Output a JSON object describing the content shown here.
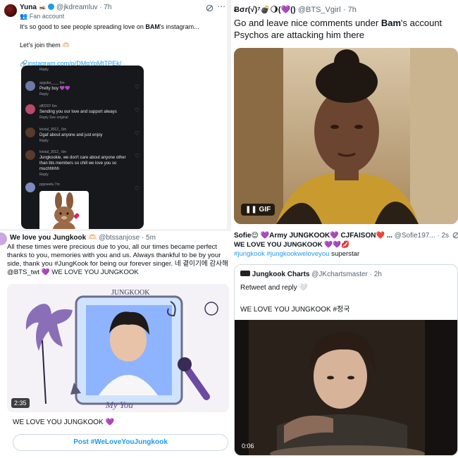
{
  "tl": {
    "name": "Yuna",
    "name_emoji": "🦗",
    "handle": "@jkdreamluv",
    "time": "· 7h",
    "fan_label": "Fan account",
    "line1_pre": "It's so good to see people spreading love on ",
    "line1_bold": "BAM",
    "line1_post": "'s instagram...",
    "line2": "Let's join them",
    "line2_emoji": "🫶🏻",
    "link": "instagram.com/p/DMgYpMtTPEk/",
    "comments": [
      {
        "user": "Reply",
        "text": "",
        "reply": ""
      },
      {
        "user": "ayguka____ 6m",
        "text": "Pretty boy 💜💜",
        "reply": "Reply"
      },
      {
        "user": "dlf2207 6m",
        "text": "Sending you our love and support always",
        "reply": "Reply   See original"
      },
      {
        "user": "kristal_3012_ 6m",
        "text": "Dgaf about anyone and just enjoy",
        "reply": "Reply"
      },
      {
        "user": "kristal_3012_ 6m",
        "text": "Jungkookie, we don't care about anyone other than bts members so chill we love you so muchhhhh",
        "reply": "Reply"
      },
      {
        "user": "pppseelu 7m",
        "text": "",
        "reply": ""
      }
    ]
  },
  "tr": {
    "name": "Ƀσɾ(√)⁷💣🌖(💜()",
    "handle": "@BTS_Vgirl",
    "time": "· 7h",
    "line1_pre": "Go and leave nice comments under ",
    "line1_bold": "Bam",
    "line1_post": "'s account",
    "line2": "Psychos are attacking him there",
    "gif_label": "GIF"
  },
  "bl": {
    "name": "We love you Jungkook",
    "name_emoji": "🫶🏻",
    "handle": "@btssanjose",
    "time": "· 5m",
    "text": "All these times were precious due to you, all our times became perfect thanks to you, memories with you and us. Always thankful to be by your side, thank you #JungKook for being our forever singer. 네 곁이기에 감사해 @BTS_twt 💜 WE LOVE YOU JUNGKOOK",
    "art_title": "JUNGKOOK",
    "art_sub": "My You",
    "video_time": "2:35",
    "footer": "WE LOVE YOU JUNGKOOK 💜",
    "post_button": "Post #WeLoveYouJungkook"
  },
  "br": {
    "name": "Sofie😌 💜Army JUNGKOOK💜 CJFAISON❤️ ...",
    "handle": "@Sofie197...",
    "time": "· 2s",
    "line2": "WE LOVE YOU JUNGKOOK 💜💜💋",
    "tag1": "#jungkook",
    "tag2": "#jungkookweloveyou",
    "tail": "superstar",
    "q_name": "Jungkook Charts",
    "q_handle": "@JKchartsmaster",
    "q_time": "· 2h",
    "q_line1": "Retweet and reply 🤍",
    "q_line2": "WE LOVE YOU JUNGKOOK #정국",
    "video_time": "0:06"
  },
  "colors": {
    "link": "#1d9bf0",
    "dark_embed": "#16181c",
    "text": "#0f1419",
    "gray": "#536471"
  }
}
